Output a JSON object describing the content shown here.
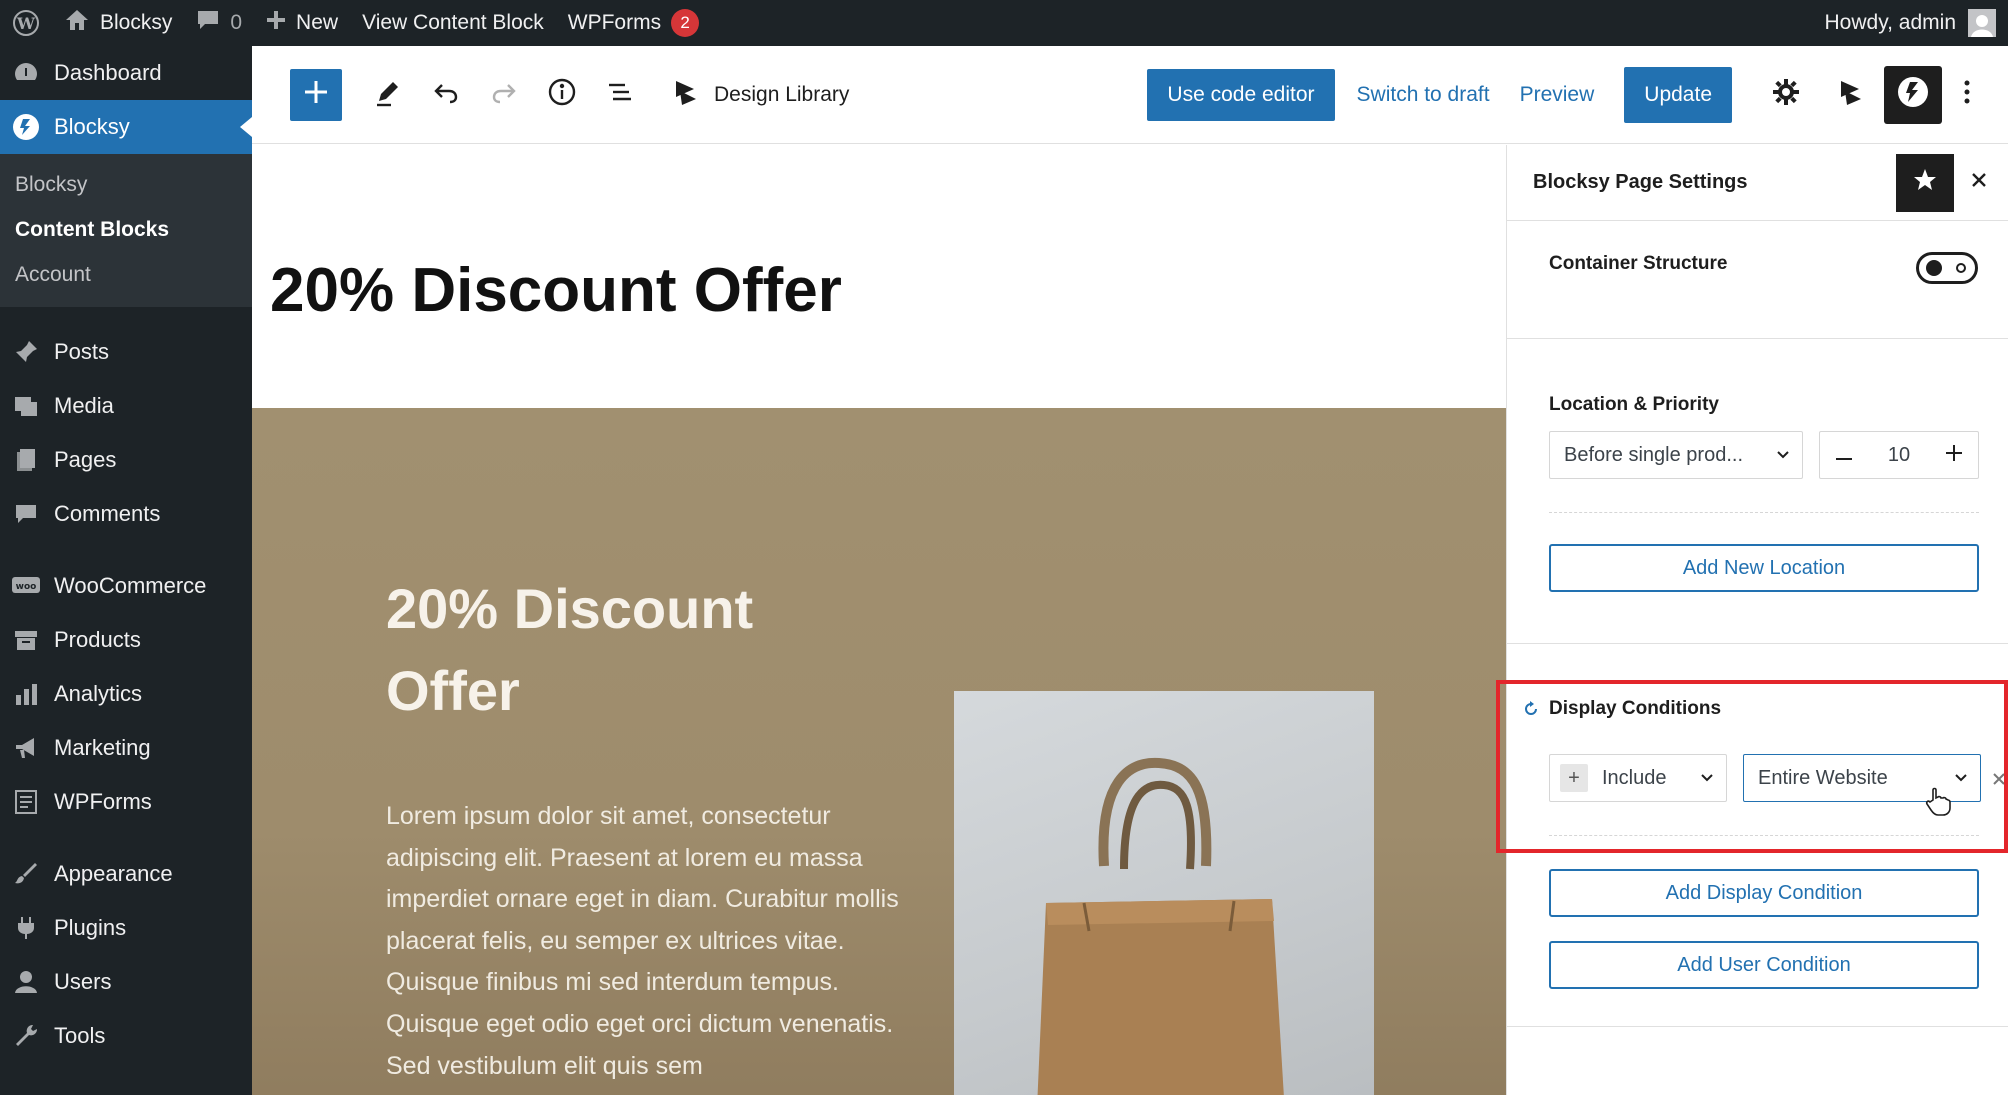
{
  "admin_bar": {
    "site_name": "Blocksy",
    "comments_count": "0",
    "new_label": "New",
    "view_label": "View Content Block",
    "wpforms_label": "WPForms",
    "wpforms_badge": "2",
    "greeting": "Howdy, admin"
  },
  "sidebar": {
    "dashboard": "Dashboard",
    "blocksy": "Blocksy",
    "submenu": [
      "Blocksy",
      "Content Blocks",
      "Account"
    ],
    "items": [
      "Posts",
      "Media",
      "Pages",
      "Comments",
      "WooCommerce",
      "Products",
      "Analytics",
      "Marketing",
      "WPForms",
      "Appearance",
      "Plugins",
      "Users",
      "Tools"
    ]
  },
  "toolbar": {
    "design_library": "Design Library",
    "code_editor": "Use code editor",
    "switch_draft": "Switch to draft",
    "preview": "Preview",
    "update": "Update"
  },
  "canvas": {
    "post_title": "20% Discount Offer",
    "hero_title": "20% Discount Offer",
    "hero_text": "Lorem ipsum dolor sit amet, consectetur adipiscing elit. Praesent at lorem eu massa imperdiet ornare eget in diam. Curabitur mollis placerat felis, eu semper ex ultrices vitae. Quisque finibus mi sed interdum tempus. Quisque eget odio eget orci dictum venenatis. Sed vestibulum elit quis sem"
  },
  "settings": {
    "title": "Blocksy Page Settings",
    "container_structure": "Container Structure",
    "location_priority": "Location & Priority",
    "location_value": "Before single prod...",
    "priority_value": "10",
    "add_location": "Add New Location",
    "display_conditions": "Display Conditions",
    "include_value": "Include",
    "condition_value": "Entire Website",
    "add_display_condition": "Add Display Condition",
    "add_user_condition": "Add User Condition"
  },
  "colors": {
    "accent": "#2271b1",
    "admin_dark": "#1d2327",
    "hero_bg": "#9e8c6c",
    "highlight": "#e3262b"
  }
}
